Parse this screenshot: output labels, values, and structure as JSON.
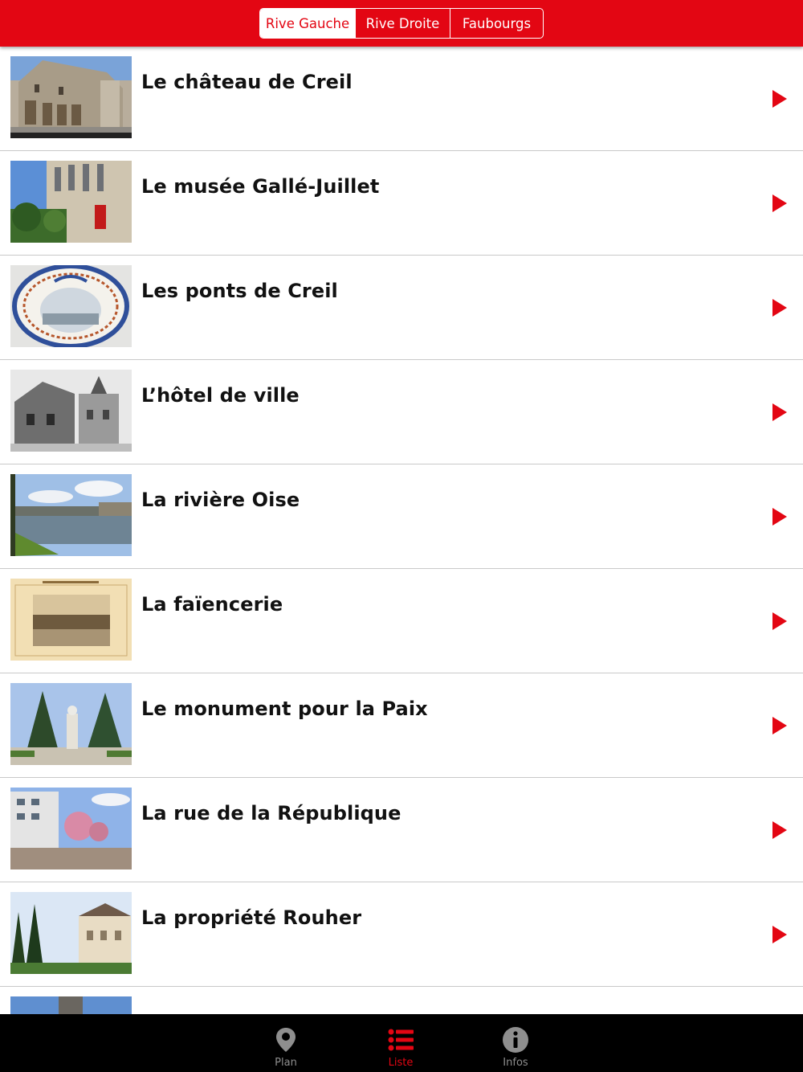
{
  "header": {
    "segments": [
      {
        "label": "Rive Gauche",
        "selected": true
      },
      {
        "label": "Rive Droite",
        "selected": false
      },
      {
        "label": "Faubourgs",
        "selected": false
      }
    ],
    "accent_color": "#e30613"
  },
  "list": {
    "items": [
      {
        "title": "Le château de Creil",
        "image": "castle-photo"
      },
      {
        "title": "Le musée Gallé-Juillet",
        "image": "museum-photo"
      },
      {
        "title": "Les ponts de Creil",
        "image": "decorated-plate-photo"
      },
      {
        "title": "L’hôtel de ville",
        "image": "town-hall-old-photo"
      },
      {
        "title": "La rivière Oise",
        "image": "river-photo"
      },
      {
        "title": "La faïencerie",
        "image": "faience-factory-print"
      },
      {
        "title": "Le monument pour la Paix",
        "image": "peace-monument-photo"
      },
      {
        "title": "La rue de la République",
        "image": "street-photo"
      },
      {
        "title": "La propriété Rouher",
        "image": "rouher-estate-photo"
      },
      {
        "title": "",
        "image": "tower-photo-partial"
      }
    ],
    "chevron_icon": "play-arrow-icon"
  },
  "tabbar": {
    "tabs": [
      {
        "label": "Plan",
        "icon": "map-pin-icon",
        "selected": false
      },
      {
        "label": "Liste",
        "icon": "list-icon",
        "selected": true
      },
      {
        "label": "Infos",
        "icon": "info-icon",
        "selected": false
      }
    ]
  }
}
